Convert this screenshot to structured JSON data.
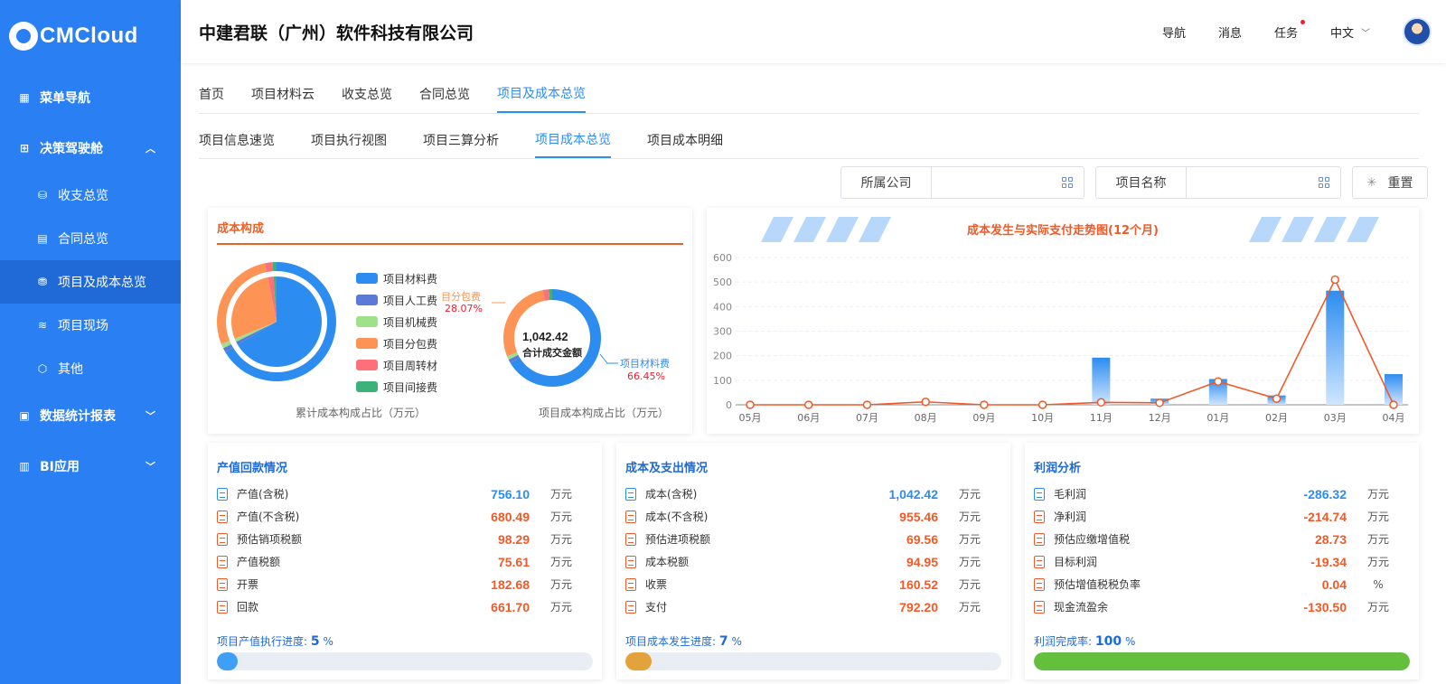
{
  "logo": {
    "text": "CMCloud"
  },
  "sidebar": {
    "items": [
      {
        "label": "菜单导航"
      },
      {
        "label": "决策驾驶舱"
      },
      {
        "label": "收支总览"
      },
      {
        "label": "合同总览"
      },
      {
        "label": "项目及成本总览"
      },
      {
        "label": "项目现场"
      },
      {
        "label": "其他"
      },
      {
        "label": "数据统计报表"
      },
      {
        "label": "BI应用"
      }
    ]
  },
  "header": {
    "company": "中建君联（广州）软件科技有限公司",
    "nav": "导航",
    "messages": "消息",
    "tasks": "任务",
    "language": "中文"
  },
  "tabs": [
    "首页",
    "项目材料云",
    "收支总览",
    "合同总览",
    "项目及成本总览"
  ],
  "subtabs": [
    "项目信息速览",
    "项目执行视图",
    "项目三算分析",
    "项目成本总览",
    "项目成本明细"
  ],
  "filters": {
    "company_label": "所属公司",
    "project_label": "项目名称",
    "reset": "重置"
  },
  "cost_panel": {
    "title": "成本构成",
    "legend": [
      {
        "name": "项目材料费",
        "color": "#2d8cf0"
      },
      {
        "name": "项目人工费",
        "color": "#5b7ad6"
      },
      {
        "name": "项目机械费",
        "color": "#9fe08a"
      },
      {
        "name": "项目分包费",
        "color": "#fd9456"
      },
      {
        "name": "项目周转材",
        "color": "#ff6f7a"
      },
      {
        "name": "项目间接费",
        "color": "#3cb27a"
      }
    ],
    "pie_caption": "累计成本构成占比（万元）",
    "donut_caption": "项目成本构成占比（万元）",
    "donut_total": "1,042.42",
    "donut_total_label": "合计成交金额",
    "callout_sub_name": "目分包费",
    "callout_sub_pct": "28.07%",
    "callout_mat_name": "项目材料费",
    "callout_mat_pct": "66.45%"
  },
  "chart_data": {
    "type": "bar",
    "title": "成本发生与实际支付走势图(12个月)",
    "categories": [
      "05月",
      "06月",
      "07月",
      "08月",
      "09月",
      "10月",
      "11月",
      "12月",
      "01月",
      "02月",
      "03月",
      "04月"
    ],
    "series": [
      {
        "type": "bar",
        "values": [
          0,
          0,
          0,
          0,
          0,
          0,
          192,
          25,
          105,
          38,
          465,
          125
        ],
        "color": "#2d8cf0"
      },
      {
        "type": "line",
        "values": [
          0,
          0,
          0,
          12,
          0,
          0,
          10,
          8,
          95,
          25,
          510,
          0
        ],
        "color": "#f05a28"
      }
    ],
    "ylim": [
      0,
      600
    ],
    "yticks": [
      "0",
      "100",
      "200",
      "300",
      "400",
      "500",
      "600"
    ],
    "grid": true
  },
  "output_panel": {
    "title": "产值回款情况",
    "rows": [
      {
        "label": "产值(含税)",
        "value": "756.10",
        "unit": "万元",
        "color": "#2d8cf0"
      },
      {
        "label": "产值(不含税)",
        "value": "680.49",
        "unit": "万元",
        "color": "#f05a28"
      },
      {
        "label": "预估销项税额",
        "value": "98.29",
        "unit": "万元",
        "color": "#f05a28"
      },
      {
        "label": "产值税额",
        "value": "75.61",
        "unit": "万元",
        "color": "#f05a28"
      },
      {
        "label": "开票",
        "value": "182.68",
        "unit": "万元",
        "color": "#f05a28"
      },
      {
        "label": "回款",
        "value": "661.70",
        "unit": "万元",
        "color": "#f05a28"
      }
    ],
    "progress_label": "项目产值执行进度:",
    "progress_value": "5",
    "progress_unit": "%",
    "progress": 5,
    "progress_color": "#3e9ff5"
  },
  "expense_panel": {
    "title": "成本及支出情况",
    "rows": [
      {
        "label": "成本(含税)",
        "value": "1,042.42",
        "unit": "万元",
        "color": "#2d8cf0"
      },
      {
        "label": "成本(不含税)",
        "value": "955.46",
        "unit": "万元",
        "color": "#f05a28"
      },
      {
        "label": "预估进项税额",
        "value": "69.56",
        "unit": "万元",
        "color": "#f05a28"
      },
      {
        "label": "成本税额",
        "value": "94.95",
        "unit": "万元",
        "color": "#f05a28"
      },
      {
        "label": "收票",
        "value": "160.52",
        "unit": "万元",
        "color": "#f05a28"
      },
      {
        "label": "支付",
        "value": "792.20",
        "unit": "万元",
        "color": "#f05a28"
      }
    ],
    "progress_label": "项目成本发生进度:",
    "progress_value": "7",
    "progress_unit": "%",
    "progress": 7,
    "progress_color": "#e3a23a"
  },
  "profit_panel": {
    "title": "利润分析",
    "rows": [
      {
        "label": "毛利润",
        "value": "-286.32",
        "unit": "万元",
        "color": "#2d8cf0"
      },
      {
        "label": "净利润",
        "value": "-214.74",
        "unit": "万元",
        "color": "#f05a28"
      },
      {
        "label": "预估应缴增值税",
        "value": "28.73",
        "unit": "万元",
        "color": "#f05a28"
      },
      {
        "label": "目标利润",
        "value": "-19.34",
        "unit": "万元",
        "color": "#f05a28"
      },
      {
        "label": "预估增值税税负率",
        "value": "0.04",
        "unit": "%",
        "color": "#f05a28"
      },
      {
        "label": "现金流盈余",
        "value": "-130.50",
        "unit": "万元",
        "color": "#f05a28"
      }
    ],
    "progress_label": "利润完成率:",
    "progress_value": "100",
    "progress_unit": "%",
    "progress": 100,
    "progress_color": "#64c03c"
  }
}
